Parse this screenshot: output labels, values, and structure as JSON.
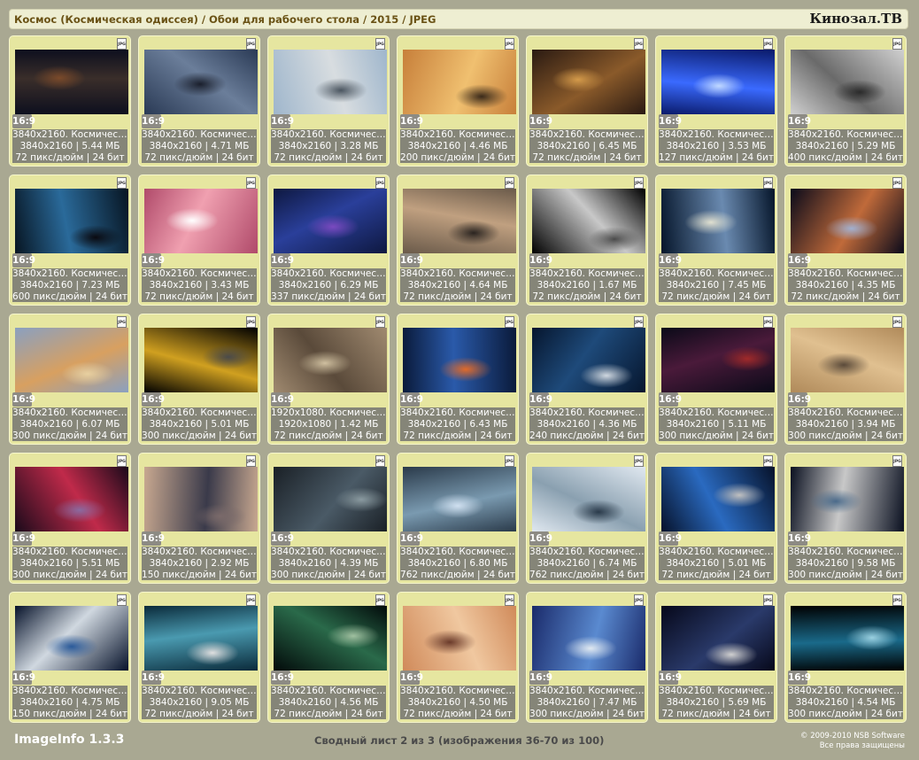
{
  "header": {
    "title": "Космос (Космическая одиссея) / Обои для рабочего стола / 2015 / JPEG",
    "brand": "Кинозал.ТВ"
  },
  "footer": {
    "app_name": "ImageInfo 1.3.3",
    "sheet_info": "Сводный лист 2 из 3 (изображения 36-70 из 100)",
    "copyright_line1": "© 2009-2010 NSB Software",
    "copyright_line2": "Все права защищены"
  },
  "badge_jpg": "JPG",
  "aspect_label": "16:9",
  "colors": {
    "background": "#a9a892",
    "card": "#e6e6a0",
    "info_panel": "#858578",
    "title_text": "#6a5215"
  },
  "thumbnails": [
    {
      "name": "3840x2160. Космическ...",
      "dims": "3840x2160 | 5.44 МБ",
      "meta": "72 пикс/дюйм | 24 бит",
      "palette": [
        "#0d0f1e",
        "#3a2e2a",
        "#7a4a2a"
      ]
    },
    {
      "name": "3840x2160. Космическ...",
      "dims": "3840x2160 | 4.71 МБ",
      "meta": "72 пикс/дюйм | 24 бит",
      "palette": [
        "#2a3a55",
        "#6b7e9a",
        "#1a1f2c"
      ]
    },
    {
      "name": "3840x2160. Космическ...",
      "dims": "3840x2160 | 3.28 МБ",
      "meta": "72 пикс/дюйм | 24 бит",
      "palette": [
        "#9fb6cc",
        "#d8dde0",
        "#4a5560"
      ]
    },
    {
      "name": "3840x2160. Космическ...",
      "dims": "3840x2160 | 4.46 МБ",
      "meta": "200 пикс/дюйм | 24 бит",
      "palette": [
        "#c77f3a",
        "#f0c070",
        "#3a2a1a"
      ]
    },
    {
      "name": "3840x2160. Космическ...",
      "dims": "3840x2160 | 6.45 МБ",
      "meta": "72 пикс/дюйм | 24 бит",
      "palette": [
        "#2a1a12",
        "#8a5a2a",
        "#d49a4a"
      ]
    },
    {
      "name": "3840x2160. Космическ...",
      "dims": "3840x2160 | 3.53 МБ",
      "meta": "127 пикс/дюйм | 24 бит",
      "palette": [
        "#0a1a6a",
        "#3a6aff",
        "#c0d8ff"
      ]
    },
    {
      "name": "3840x2160. Космическ...",
      "dims": "3840x2160 | 5.29 МБ",
      "meta": "400 пикс/дюйм | 24 бит",
      "palette": [
        "#d0d0d0",
        "#6a6a6a",
        "#2a2a2a"
      ]
    },
    {
      "name": "3840x2160. Космическ...",
      "dims": "3840x2160 | 7.23 МБ",
      "meta": "600 пикс/дюйм | 24 бит",
      "palette": [
        "#071522",
        "#2a6a9a",
        "#0a0a10"
      ]
    },
    {
      "name": "3840x2160. Космическ...",
      "dims": "3840x2160 | 3.43 МБ",
      "meta": "72 пикс/дюйм | 24 бит",
      "palette": [
        "#b04a6a",
        "#f0a0b0",
        "#ffffff"
      ]
    },
    {
      "name": "3840x2160. Космическ...",
      "dims": "3840x2160 | 6.29 МБ",
      "meta": "337 пикс/дюйм | 24 бит",
      "palette": [
        "#0e1840",
        "#2a3f9a",
        "#7a4ac0"
      ]
    },
    {
      "name": "3840x2160. Космическ...",
      "dims": "3840x2160 | 4.64 МБ",
      "meta": "72 пикс/дюйм | 24 бит",
      "palette": [
        "#6a5a4a",
        "#c0a080",
        "#2a2420"
      ]
    },
    {
      "name": "3840x2160. Космическ...",
      "dims": "3840x2160 | 1.67 МБ",
      "meta": "72 пикс/дюйм | 24 бит",
      "palette": [
        "#000000",
        "#c8c8c8",
        "#4a4a4a"
      ]
    },
    {
      "name": "3840x2160. Космическ...",
      "dims": "3840x2160 | 7.45 МБ",
      "meta": "72 пикс/дюйм | 24 бит",
      "palette": [
        "#05152a",
        "#6a8ab0",
        "#e0e0d0"
      ]
    },
    {
      "name": "3840x2160. Космическ...",
      "dims": "3840x2160 | 4.35 МБ",
      "meta": "72 пикс/дюйм | 24 бит",
      "palette": [
        "#0a0a1a",
        "#c06a3a",
        "#a0b0d0"
      ]
    },
    {
      "name": "3840x2160. Космическ...",
      "dims": "3840x2160 | 6.07 МБ",
      "meta": "300 пикс/дюйм | 24 бит",
      "palette": [
        "#8aa0c0",
        "#d8a060",
        "#e8d0a0"
      ]
    },
    {
      "name": "3840x2160. Космическ...",
      "dims": "3840x2160 | 5.01 МБ",
      "meta": "300 пикс/дюйм | 24 бит",
      "palette": [
        "#000000",
        "#d0a020",
        "#4a4a4a"
      ]
    },
    {
      "name": "1920x1080. Космическ...",
      "dims": "1920x1080 | 1.42 МБ",
      "meta": "72 пикс/дюйм | 24 бит",
      "palette": [
        "#a08a70",
        "#5a4a3a",
        "#d0c0a0"
      ]
    },
    {
      "name": "3840x2160. Космическ...",
      "dims": "3840x2160 | 6.43 МБ",
      "meta": "72 пикс/дюйм | 24 бит",
      "palette": [
        "#0a1a3a",
        "#2a5aaa",
        "#e06a2a"
      ]
    },
    {
      "name": "3840x2160. Космическ...",
      "dims": "3840x2160 | 4.36 МБ",
      "meta": "240 пикс/дюйм | 24 бит",
      "palette": [
        "#06162e",
        "#1e4a7a",
        "#d0d8e0"
      ]
    },
    {
      "name": "3840x2160. Космическ...",
      "dims": "3840x2160 | 5.11 МБ",
      "meta": "300 пикс/дюйм | 24 бит",
      "palette": [
        "#0a0a18",
        "#4a1a3a",
        "#a02a2a"
      ]
    },
    {
      "name": "3840x2160. Космическ...",
      "dims": "3840x2160 | 3.94 МБ",
      "meta": "300 пикс/дюйм | 24 бит",
      "palette": [
        "#b08a5a",
        "#e0c090",
        "#5a4a3a"
      ]
    },
    {
      "name": "3840x2160. Космическ...",
      "dims": "3840x2160 | 5.51 МБ",
      "meta": "300 пикс/дюйм | 24 бит",
      "palette": [
        "#1a0a1a",
        "#c02a4a",
        "#8a6aa0"
      ]
    },
    {
      "name": "3840x2160. Космическ...",
      "dims": "3840x2160 | 2.92 МБ",
      "meta": "150 пикс/дюйм | 24 бит",
      "palette": [
        "#c8a890",
        "#3a3a4a",
        "#7a6a6a"
      ]
    },
    {
      "name": "3840x2160. Космическ...",
      "dims": "3840x2160 | 4.39 МБ",
      "meta": "300 пикс/дюйм | 24 бит",
      "palette": [
        "#1a2026",
        "#4a5a66",
        "#8a9aa0"
      ]
    },
    {
      "name": "3840x2160. Космическ...",
      "dims": "3840x2160 | 6.80 МБ",
      "meta": "762 пикс/дюйм | 24 бит",
      "palette": [
        "#2a3a4a",
        "#7a9ab0",
        "#d0e0f0"
      ]
    },
    {
      "name": "3840x2160. Космическ...",
      "dims": "3840x2160 | 6.74 МБ",
      "meta": "762 пикс/дюйм | 24 бит",
      "palette": [
        "#e0e8f0",
        "#8aa0b0",
        "#2a3a4a"
      ]
    },
    {
      "name": "3840x2160. Космическ...",
      "dims": "3840x2160 | 5.01 МБ",
      "meta": "72 пикс/дюйм | 24 бит",
      "palette": [
        "#06122a",
        "#2a6ac0",
        "#c0c0c0"
      ]
    },
    {
      "name": "3840x2160. Космическ...",
      "dims": "3840x2160 | 9.58 МБ",
      "meta": "300 пикс/дюйм | 24 бит",
      "palette": [
        "#0a1020",
        "#c8c8c8",
        "#4a6a8a"
      ]
    },
    {
      "name": "3840x2160. Космическ...",
      "dims": "3840x2160 | 4.75 МБ",
      "meta": "150 пикс/дюйм | 24 бит",
      "palette": [
        "#06122a",
        "#d0d8e0",
        "#2a5a9a"
      ]
    },
    {
      "name": "3840x2160. Космическ...",
      "dims": "3840x2160 | 9.05 МБ",
      "meta": "72 пикс/дюйм | 24 бит",
      "palette": [
        "#0a2a3a",
        "#4a9ab0",
        "#e0e0e0"
      ]
    },
    {
      "name": "3840x2160. Космическ...",
      "dims": "3840x2160 | 4.56 МБ",
      "meta": "72 пикс/дюйм | 24 бит",
      "palette": [
        "#020a0a",
        "#2a6a4a",
        "#a0c0a0"
      ]
    },
    {
      "name": "3840x2160. Космическ...",
      "dims": "3840x2160 | 4.50 МБ",
      "meta": "72 пикс/дюйм | 24 бит",
      "palette": [
        "#d08a5a",
        "#f0c8a0",
        "#6a3a2a"
      ]
    },
    {
      "name": "3840x2160. Космическ...",
      "dims": "3840x2160 | 7.47 МБ",
      "meta": "300 пикс/дюйм | 24 бит",
      "palette": [
        "#1a2a6a",
        "#5a8ad0",
        "#e0e8f0"
      ]
    },
    {
      "name": "3840x2160. Космическ...",
      "dims": "3840x2160 | 5.69 МБ",
      "meta": "72 пикс/дюйм | 24 бит",
      "palette": [
        "#06081a",
        "#2a3a6a",
        "#d0d0d0"
      ]
    },
    {
      "name": "3840x2160. Космическ...",
      "dims": "3840x2160 | 4.54 МБ",
      "meta": "300 пикс/дюйм | 24 бит",
      "palette": [
        "#000000",
        "#1a6a8a",
        "#9ad0e0"
      ]
    }
  ]
}
